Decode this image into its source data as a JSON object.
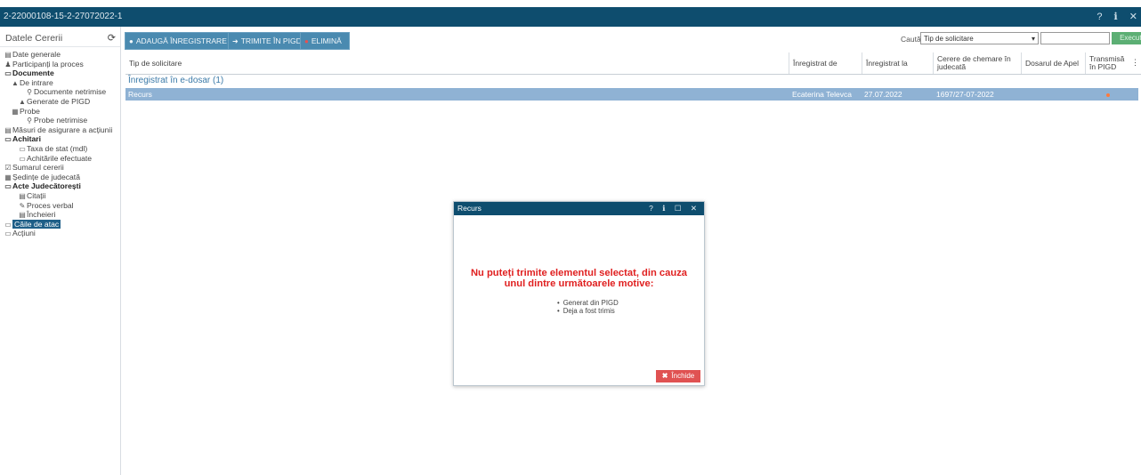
{
  "window": {
    "title": "2-22000108-15-2-27072022-1",
    "icons": [
      "?",
      "ℹ",
      "✕"
    ]
  },
  "sidebar": {
    "header": "Datele Cererii",
    "items": [
      {
        "label": "Date generale",
        "icon": "doc-icon",
        "bold": false,
        "indent": 0
      },
      {
        "label": "Participanți la proces",
        "icon": "people-icon",
        "bold": false,
        "indent": 0
      },
      {
        "label": "Documente",
        "icon": "folder-icon",
        "bold": true,
        "indent": 0
      },
      {
        "label": "De intrare",
        "icon": "inbox-icon",
        "bold": false,
        "indent": 1
      },
      {
        "label": "Documente netrimise",
        "icon": "unsent-icon",
        "bold": false,
        "indent": 3
      },
      {
        "label": "Generate de PIGD",
        "icon": "inbox-icon",
        "bold": false,
        "indent": 2
      },
      {
        "label": "Probe",
        "icon": "evidence-icon",
        "bold": false,
        "indent": 1
      },
      {
        "label": "Probe netrimise",
        "icon": "unsent-icon",
        "bold": false,
        "indent": 3
      },
      {
        "label": "Măsuri de asigurare a acțiunii",
        "icon": "doc-icon",
        "bold": false,
        "indent": 0
      },
      {
        "label": "Achitari",
        "icon": "folder-icon",
        "bold": true,
        "indent": 0
      },
      {
        "label": "Taxa de stat (mdl)",
        "icon": "folder-icon",
        "bold": false,
        "indent": 2
      },
      {
        "label": "Achitările efectuate",
        "icon": "folder-icon",
        "bold": false,
        "indent": 2
      },
      {
        "label": "Sumarul cererii",
        "icon": "check-icon",
        "bold": false,
        "indent": 0
      },
      {
        "label": "Ședințe de judecată",
        "icon": "calendar-icon",
        "bold": false,
        "indent": 0
      },
      {
        "label": "Acte Judecătorești",
        "icon": "folder-icon",
        "bold": true,
        "indent": 0
      },
      {
        "label": "Citații",
        "icon": "doc-icon",
        "bold": false,
        "indent": 2
      },
      {
        "label": "Proces verbal",
        "icon": "edit-icon",
        "bold": false,
        "indent": 2
      },
      {
        "label": "Încheieri",
        "icon": "doc-icon",
        "bold": false,
        "indent": 2
      },
      {
        "label": "Căile de atac",
        "icon": "folder-icon",
        "bold": false,
        "indent": 0,
        "selected": true
      },
      {
        "label": "Acțiuni",
        "icon": "folder-icon",
        "bold": false,
        "indent": 0
      }
    ]
  },
  "toolbar": {
    "add_label": "ADAUGĂ ÎNREGISTRARE",
    "send_label": "TRIMITE ÎN PIGD",
    "delete_label": "ELIMINĂ"
  },
  "search": {
    "label": "Caută:",
    "select_value": "Tip de solicitare",
    "input_value": "",
    "exec_label": "Execută"
  },
  "grid": {
    "columns": [
      "Tip de solicitare",
      "Înregistrat de",
      "Înregistrat la",
      "Cerere de chemare în judecată",
      "Dosarul de Apel",
      "Transmisă în PIGD"
    ],
    "group_label": "Înregistrat în e-dosar (1)",
    "rows": [
      {
        "type": "Recurs",
        "registered_by": "Ecaterina Televca",
        "registered_at": "27.07.2022",
        "claim": "1697/27-07-2022",
        "appeal_file": "",
        "sent_status": "pending"
      }
    ]
  },
  "modal": {
    "title": "Recurs",
    "controls": [
      "?",
      "ℹ",
      "☐",
      "✕"
    ],
    "message": "Nu puteți trimite elementul selectat, din cauza unul dintre următoarele motive:",
    "reasons": [
      "Generat din PIGD",
      "Deja a fost trimis"
    ],
    "close_label": "Închide"
  },
  "colors": {
    "titlebar": "#0e4d6e",
    "accent": "#4a8ab0",
    "selected_row": "#8fb2d4",
    "error": "#e02020",
    "close_button": "#e05252",
    "exec_button": "#5caf74"
  }
}
